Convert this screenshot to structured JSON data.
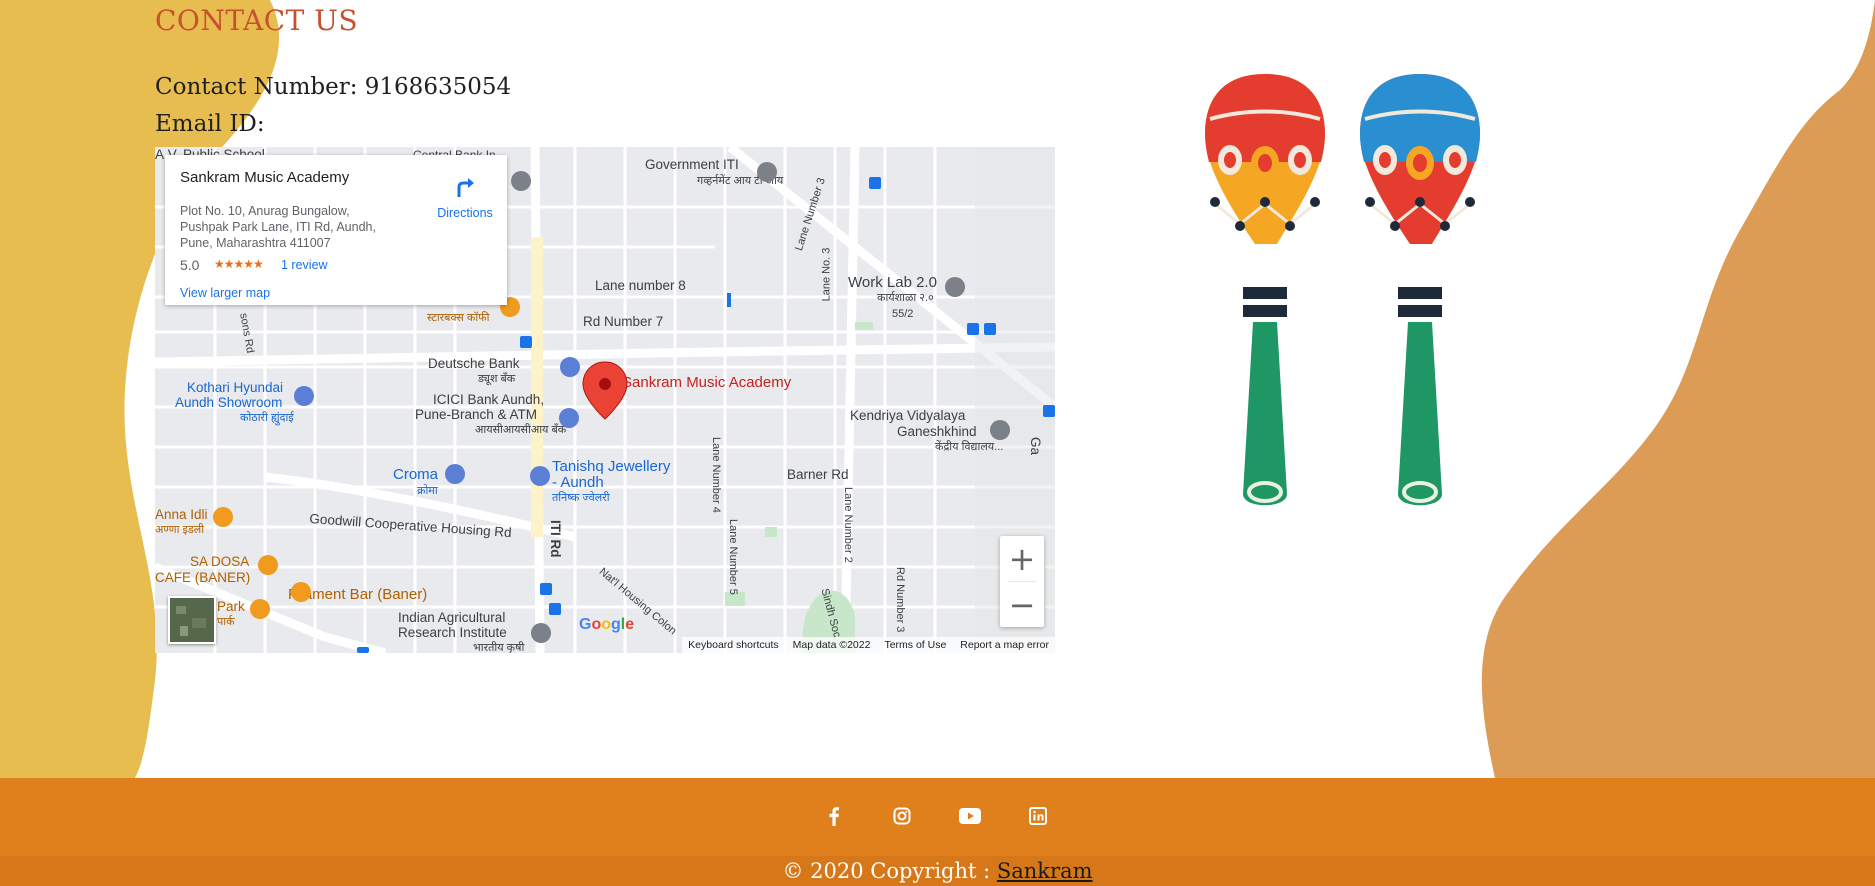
{
  "contact": {
    "heading": "CONTACT US",
    "phone_label": "Contact Number: 9168635054",
    "email_label": "Email ID:"
  },
  "map": {
    "card": {
      "place_name": "Sankram Music Academy",
      "address": "Plot No. 10, Anurag Bungalow, Pushpak Park Lane, ITI Rd, Aundh, Pune, Maharashtra 411007",
      "rating": "5.0",
      "stars": "★★★★★",
      "reviews": "1 review",
      "larger_map": "View larger map",
      "directions": "Directions"
    },
    "labels": {
      "public_school": "A.V. Public School",
      "central_bank": "Central Bank In",
      "government_iti": "Government ITI",
      "government_iti_mr": "गव्हर्नमेंट आय टी आय",
      "lane_number_3": "Lane Number 3",
      "lane_no_3": "Lane No. 3",
      "lane_number_8": "Lane number 8",
      "rd_number_7": "Rd Number 7",
      "work_lab": "Work Lab 2.0",
      "work_lab_mr": "कार्यशाळा २.०",
      "work_lab_num": "55/2",
      "starbucks_mr": "स्टारबक्स कॉफी",
      "parsons_rd": "sons Rd",
      "deutsche_bank": "Deutsche Bank",
      "deutsche_bank_mr": "ड्यूश बँक",
      "kothari_hyundai": "Kothari Hyundai",
      "aundh_showroom": "Aundh Showroom",
      "kothari_mr": "कोठारी ह्युंदाई",
      "icici": "ICICI Bank Aundh,",
      "icici_2": "Pune-Branch & ATM",
      "icici_mr": "आयसीआयसीआय बँक",
      "sankram_pin": "Sankram Music Academy",
      "kendriya": "Kendriya Vidyalaya",
      "ganeshkhind": "Ganeshkhind",
      "kendriya_mr": "केंद्रीय विद्यालय...",
      "lane_number_4": "Lane Number 4",
      "barner_rd": "Barner Rd",
      "croma": "Croma",
      "croma_mr": "क्रोमा",
      "tanishq": "Tanishq Jewellery",
      "tanishq_2": "- Aundh",
      "tanishq_mr": "तनिष्क ज्वेलरी",
      "anna_idli": "Anna Idli",
      "anna_idli_mr": "अण्णा इडली",
      "goodwill_rd": "Goodwill Cooperative Housing Rd",
      "iti_rd": "ITI Rd",
      "lane_number_5": "Lane Number 5",
      "lane_number_2": "Lane Number 2",
      "rd_number_3": "Rd Number 3",
      "natl_housing": "Nat'l Housing Colon",
      "sindh_soc": "Sindh Soc",
      "sa_dosa": "SA DOSA",
      "cafe_baner": "CAFE (BANER)",
      "filament_bar": "Filament Bar (Baner)",
      "park": "Park",
      "park_mr": "पार्क",
      "iari": "Indian Agricultural",
      "iari_2": "Research Institute",
      "iari_mr": "भारतीय कृषी",
      "ga": "Ga"
    },
    "zoom_in": "+",
    "zoom_out": "−",
    "attribution": {
      "shortcuts": "Keyboard shortcuts",
      "map_data": "Map data ©2022",
      "terms": "Terms of Use",
      "report": "Report a map error"
    }
  },
  "social": {
    "icons": [
      "facebook-icon",
      "instagram-icon",
      "youtube-icon",
      "linkedin-icon"
    ]
  },
  "footer": {
    "copyright_prefix": "© 2020 Copyright : ",
    "brand_link": "Sankram"
  },
  "colors": {
    "heading": "#c8502e",
    "left_blob": "#e8bd4f",
    "right_blob": "#dc9c56",
    "social_bar": "#e0801c",
    "copyright_bar": "#d67819"
  }
}
